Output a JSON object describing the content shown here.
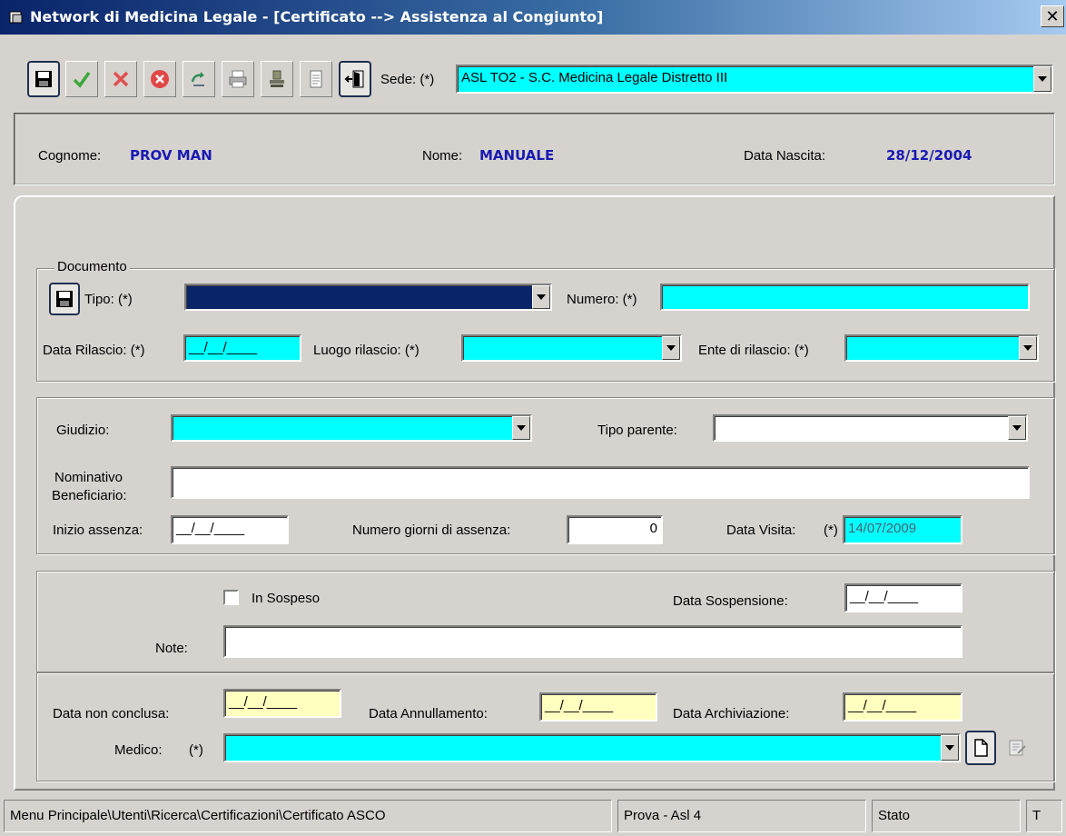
{
  "window": {
    "title": "Network di Medicina Legale - [Certificato --> Assistenza al Congiunto]",
    "close_glyph": "✕"
  },
  "toolbar": {
    "buttons": [
      {
        "name": "save-icon"
      },
      {
        "name": "confirm-check-icon"
      },
      {
        "name": "cancel-x-icon"
      },
      {
        "name": "delete-stop-icon"
      },
      {
        "name": "refresh-icon"
      },
      {
        "name": "print-icon"
      },
      {
        "name": "stamp-icon"
      },
      {
        "name": "document-icon"
      },
      {
        "name": "exit-door-icon"
      }
    ],
    "sede_label": "Sede: (*)",
    "sede_value": "ASL TO2 - S.C. Medicina Legale Distretto III"
  },
  "patient": {
    "cognome_label": "Cognome:",
    "cognome_value": "PROV MAN",
    "nome_label": "Nome:",
    "nome_value": "MANUALE",
    "nascita_label": "Data Nascita:",
    "nascita_value": "28/12/2004"
  },
  "documento": {
    "legend": "Documento",
    "tipo_label": "Tipo: (*)",
    "tipo_value": "",
    "numero_label": "Numero: (*)",
    "numero_value": "",
    "data_rilascio_label": "Data Rilascio: (*)",
    "data_rilascio_value": "__/__/____",
    "luogo_label": "Luogo rilascio: (*)",
    "luogo_value": "",
    "ente_label": "Ente di rilascio: (*)",
    "ente_value": ""
  },
  "assistenza": {
    "giudizio_label": "Giudizio:",
    "giudizio_value": "",
    "tipo_parente_label": "Tipo parente:",
    "tipo_parente_value": "",
    "nominativo_label_1": "Nominativo",
    "nominativo_label_2": "Beneficiario:",
    "nominativo_value": "",
    "inizio_label": "Inizio assenza:",
    "inizio_value": "__/__/____",
    "giorni_label": "Numero giorni di assenza:",
    "giorni_value": "0",
    "visita_label": "Data Visita:",
    "visita_req": "(*)",
    "visita_value": "14/07/2009"
  },
  "sospeso": {
    "checkbox_label": "In Sospeso",
    "checked": false,
    "data_sosp_label": "Data Sospensione:",
    "data_sosp_value": "__/__/____",
    "note_label": "Note:",
    "note_value": ""
  },
  "chiusura": {
    "non_conclusa_label": "Data non conclusa:",
    "non_conclusa_value": "__/__/____",
    "annullamento_label": "Data Annullamento:",
    "annullamento_value": "__/__/____",
    "archiviazione_label": "Data Archiviazione:",
    "archiviazione_value": "__/__/____",
    "medico_label": "Medico:",
    "medico_req": "(*)",
    "medico_value": ""
  },
  "statusbar": {
    "path": "Menu Principale\\Utenti\\Ricerca\\Certificazioni\\Certificato ASCO",
    "user": "Prova - Asl 4",
    "stato": "Stato",
    "extra": "T"
  },
  "colors": {
    "required_field": "#00ffff",
    "date_field_yellow": "#ffffc0",
    "patient_value": "#1a1ab4"
  }
}
